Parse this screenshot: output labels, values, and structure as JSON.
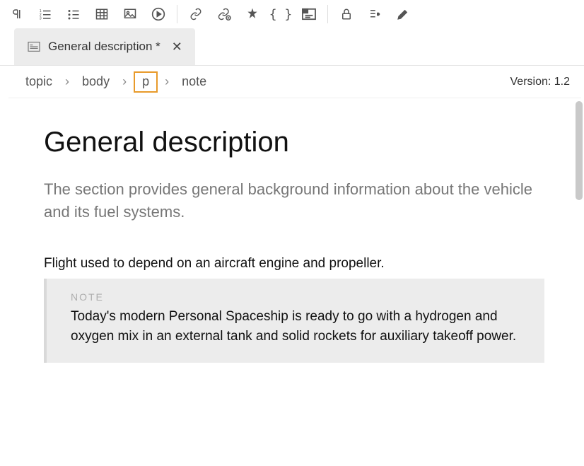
{
  "toolbar": {
    "icons": [
      "pilcrow-icon",
      "ordered-list-icon",
      "bullet-list-icon",
      "table-icon",
      "image-icon",
      "video-icon",
      "link-icon",
      "link-edit-icon",
      "star-icon",
      "braces-icon",
      "label-box-icon",
      "lock-icon",
      "list-tag-icon",
      "highlighter-icon"
    ]
  },
  "tab": {
    "title": "General description *"
  },
  "breadcrumb": {
    "items": [
      "topic",
      "body",
      "p",
      "note"
    ],
    "selected_index": 2
  },
  "version_label": "Version: 1.2",
  "content": {
    "title": "General description",
    "lead": "The section provides general background information about the vehicle and its fuel systems.",
    "paragraph": "Flight used to depend on an aircraft engine and propeller.",
    "note_label": "NOTE",
    "note_text": " Today's modern Personal Spaceship is ready to go with a hydrogen and oxygen mix in an external tank and solid rockets for auxiliary takeoff power."
  }
}
